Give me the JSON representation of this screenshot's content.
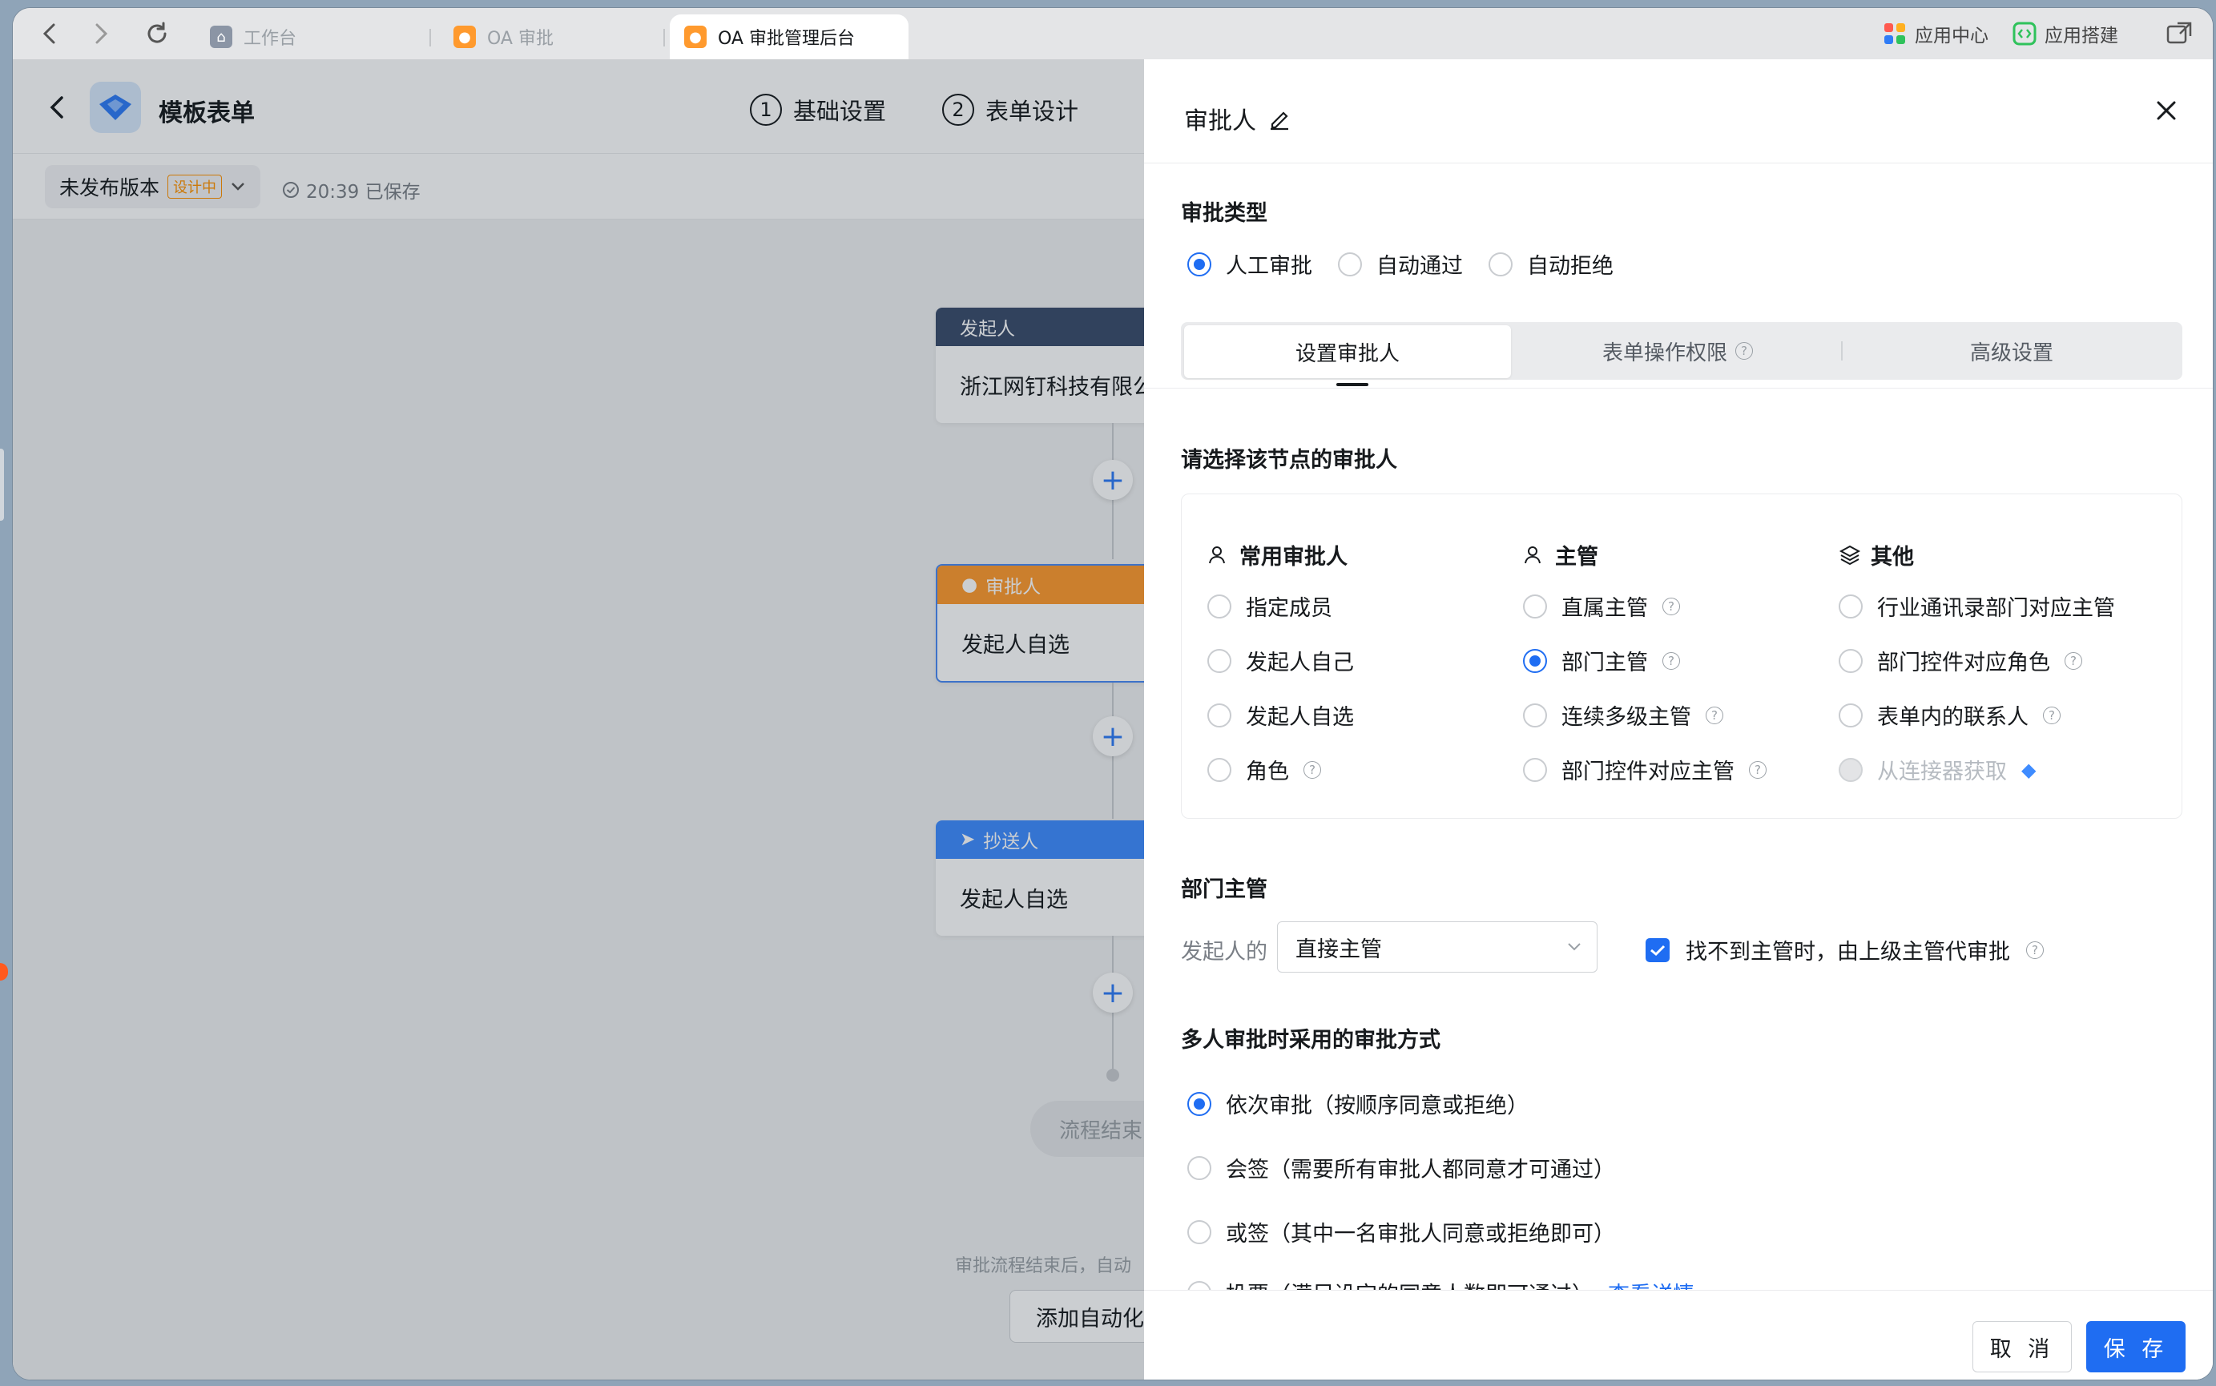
{
  "browser": {
    "tabs": [
      {
        "label": "工作台",
        "icon": "org-icon",
        "color": "#8b95a5"
      },
      {
        "label": "OA 审批",
        "icon": "user-icon",
        "color": "#ff9a2e"
      },
      {
        "label": "OA 审批管理后台",
        "icon": "user-icon",
        "color": "#ff9a2e"
      }
    ],
    "tools": {
      "app_center": "应用中心",
      "app_build": "应用搭建"
    }
  },
  "header": {
    "app_title": "模板表单",
    "steps": [
      {
        "num": "1",
        "label": "基础设置"
      },
      {
        "num": "2",
        "label": "表单设计"
      }
    ],
    "version_label": "未发布版本",
    "version_badge": "设计中",
    "saved_text": "20:39 已保存"
  },
  "flow": {
    "nodes": [
      {
        "head": "发起人",
        "body": "浙江网钉科技有限公",
        "color": "#3a4c6b"
      },
      {
        "head": "审批人",
        "body": "发起人自选",
        "color": "#ff9a2e"
      },
      {
        "head": "抄送人",
        "body": "发起人自选",
        "color": "#3f8cff"
      }
    ],
    "end_label": "流程结束",
    "auto_hint": "审批流程结束后，自动",
    "auto_button": "添加自动化"
  },
  "drawer": {
    "title": "审批人",
    "approval_type_title": "审批类型",
    "approval_types": [
      "人工审批",
      "自动通过",
      "自动拒绝"
    ],
    "tabs": [
      "设置审批人",
      "表单操作权限",
      "高级设置"
    ],
    "choose_title": "请选择该节点的审批人",
    "col_common": "常用审批人",
    "col_manager": "主管",
    "col_other": "其他",
    "common_items": [
      "指定成员",
      "发起人自己",
      "发起人自选",
      "角色"
    ],
    "manager_items": [
      "直属主管",
      "部门主管",
      "连续多级主管",
      "部门控件对应主管"
    ],
    "other_items": [
      "行业通讯录部门对应主管",
      "部门控件对应角色",
      "表单内的联系人",
      "从连接器获取"
    ],
    "dept_title": "部门主管",
    "initiator_of": "发起人的",
    "select_value": "直接主管",
    "fallback_label": "找不到主管时，由上级主管代审批",
    "multi_title": "多人审批时采用的审批方式",
    "multi_items": [
      "依次审批（按顺序同意或拒绝）",
      "会签（需要所有审批人都同意才可通过）",
      "或签（其中一名审批人同意或拒绝即可）",
      "投票（满足设定的同意人数即可通过）"
    ],
    "view_detail": "查看详情",
    "cancel": "取 消",
    "save": "保 存",
    "accent": "#1f6df2"
  }
}
